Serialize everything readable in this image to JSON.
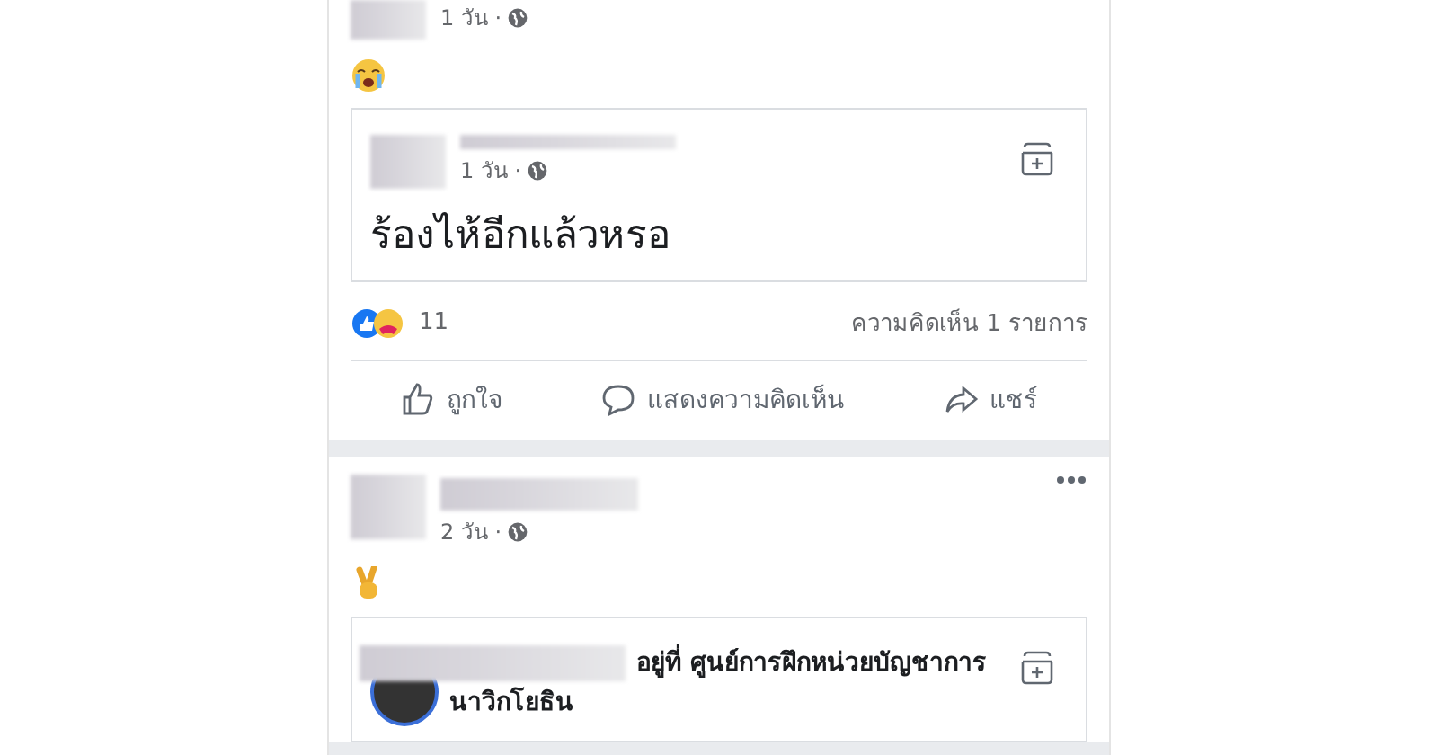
{
  "posts": [
    {
      "kind": "crying",
      "time": "1 วัน ·",
      "shared": {
        "kind": "text",
        "time": "1 วัน ·",
        "text": "ร้องไห้อีกแล้วหรอ"
      },
      "reactions_count": "11",
      "comments_count": "ความคิดเห็น 1 รายการ",
      "actions": [
        "ถูกใจ",
        "แสดงความคิดเห็น",
        "แชร์"
      ]
    },
    {
      "kind": "peace",
      "time": "2 วัน ·",
      "shared": {
        "kind": "checkin",
        "lines": [
          "อยู่ที่ ศูนย์การฝึกหน่วยบัญชาการ",
          "นาวิกโยธิน"
        ]
      }
    }
  ]
}
